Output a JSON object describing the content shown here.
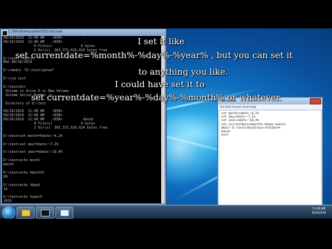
{
  "cmd": {
    "title": "C:\\Windows\\system32\\cmd.exe",
    "lines": [
      "09/16/2019  11:48 AM    <DIR>          .",
      "09/16/2019  11:48 AM    <DIR>          ..",
      "               0 File(s)              0 bytes",
      "               2 Dir(s)  363,372,626,624 bytes free",
      "",
      "D:\\>echo %date%",
      "Mon 09/16/2019",
      "",
      "D:\\>mkdir \"D:\\test\\dated\"",
      "",
      "D:\\>cd test",
      "",
      "D:\\test>dir",
      " Volume in drive D is New Volume",
      " Volume Serial Number is ....",
      "",
      " Directory of D:\\test",
      "",
      "09/16/2019  11:48 AM    <DIR>          .",
      "09/16/2019  11:48 AM    <DIR>          ..",
      "09/16/2019  11:48 AM    <DIR>          dated",
      "               0 File(s)              0 bytes",
      "               3 Dir(s)  363,372,626,624 bytes free",
      "",
      "D:\\test>set month=%date:~4,2%",
      "",
      "D:\\test>set day=%date:~7,2%",
      "",
      "D:\\test>set year=%date:~10,4%",
      "",
      "D:\\test>echo month",
      "month",
      "",
      "D:\\test>echo %month%",
      "09",
      "",
      "D:\\test>echo %day%",
      "16",
      "",
      "D:\\test>echo %year%",
      "2019",
      "",
      "D:\\test>set currentdate=%month%-%day%-%year%",
      "",
      "D:\\test>"
    ]
  },
  "notepad": {
    "title": "dates.txt",
    "menu": "File  Edit  Format  View  Help",
    "lines": [
      "set month=%date:~4,2%",
      "set day=%date:~7,2%",
      "set year=%date:~10,4%",
      "set currentdate=%month%-%day%-%year%",
      "mkdir D:\\test\\dated\\%currentdate%",
      "pause",
      "exit"
    ]
  },
  "captions": {
    "line1": "I set it like",
    "line2": "set currentdate=%month%-%day%-%year% , but you can set it",
    "line3": "to anything you like.",
    "line4": "I could have set it to",
    "line5": "set currentdate=%year%-%day%-%month% or whatever."
  },
  "taskbar": {
    "clock_time": "11:49 AM",
    "clock_date": "9/16/2019"
  },
  "icons": {
    "start": "windows-start-orb-icon",
    "explorer": "folder-icon",
    "cmd": "command-prompt-icon",
    "notepad": "notepad-icon"
  }
}
